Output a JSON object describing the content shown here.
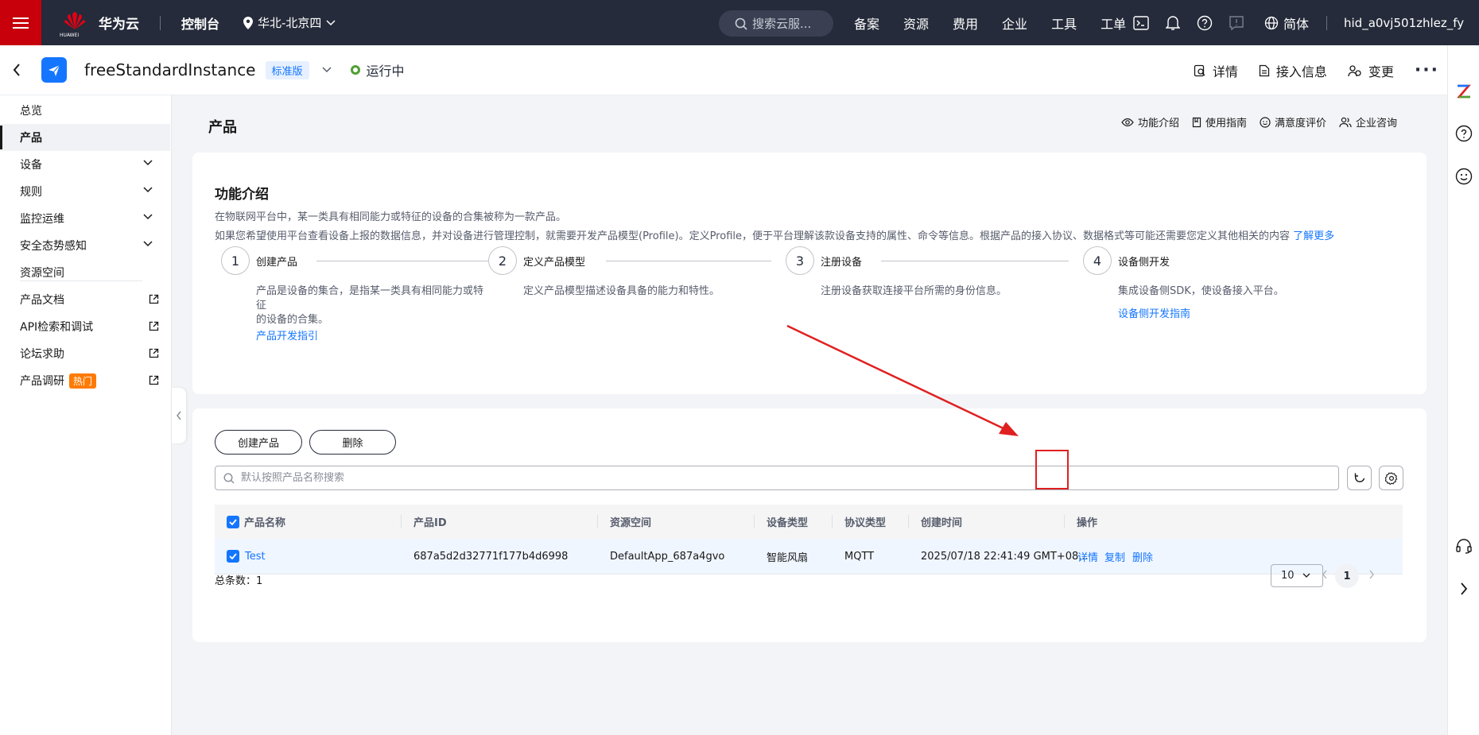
{
  "topbar": {
    "brand_small": "HUAWEI",
    "brand": "华为云",
    "console": "控制台",
    "region": "华北-北京四",
    "search_placeholder": "搜索云服...",
    "links": [
      "备案",
      "资源",
      "费用",
      "企业",
      "工具",
      "工单"
    ],
    "language": "简体",
    "user": "hid_a0vj501zhlez_fy"
  },
  "instance": {
    "name": "freeStandardInstance",
    "edition": "标准版",
    "status": "运行中",
    "actions": {
      "detail": "详情",
      "access_info": "接入信息",
      "change": "变更"
    }
  },
  "sidebar": {
    "items": [
      {
        "label": "总览"
      },
      {
        "label": "产品"
      },
      {
        "label": "设备"
      },
      {
        "label": "规则"
      },
      {
        "label": "监控运维"
      },
      {
        "label": "安全态势感知"
      },
      {
        "label": "资源空间"
      },
      {
        "label": "产品文档"
      },
      {
        "label": "API检索和调试"
      },
      {
        "label": "论坛求助"
      },
      {
        "label": "产品调研"
      }
    ],
    "hot_badge": "热门"
  },
  "page": {
    "title": "产品",
    "links": {
      "intro": "功能介绍",
      "guide": "使用指南",
      "rating": "满意度评价",
      "consult": "企业咨询"
    }
  },
  "intro": {
    "title": "功能介绍",
    "desc1": "在物联网平台中，某一类具有相同能力或特征的设备的合集被称为一款产品。",
    "desc2": "如果您希望使用平台查看设备上报的数据信息，并对设备进行管理控制，就需要开发产品模型(Profile)。定义Profile，便于平台理解该款设备支持的属性、命令等信息。根据产品的接入协议、数据格式等可能还需要您定义其他相关的内容",
    "learn_more": "了解更多",
    "steps": [
      {
        "num": "1",
        "title": "创建产品",
        "desc_line1": "产品是设备的集合，是指某一类具有相同能力或特征",
        "desc_line2": "的设备的合集。",
        "link": "产品开发指引"
      },
      {
        "num": "2",
        "title": "定义产品模型",
        "desc_line1": "定义产品模型描述设备具备的能力和特性。",
        "desc_line2": "",
        "link": ""
      },
      {
        "num": "3",
        "title": "注册设备",
        "desc_line1": "注册设备获取连接平台所需的身份信息。",
        "desc_line2": "",
        "link": ""
      },
      {
        "num": "4",
        "title": "设备侧开发",
        "desc_line1": "集成设备侧SDK，使设备接入平台。",
        "desc_line2": "",
        "link": "设备侧开发指南"
      }
    ]
  },
  "products": {
    "create_button": "创建产品",
    "delete_button": "删除",
    "search_placeholder": "默认按照产品名称搜索",
    "columns": [
      "产品名称",
      "产品ID",
      "资源空间",
      "设备类型",
      "协议类型",
      "创建时间",
      "操作"
    ],
    "rows": [
      {
        "name": "Test",
        "id": "687a5d2d32771f177b4d6998",
        "space": "DefaultApp_687a4gvo",
        "device_type": "智能风扇",
        "protocol": "MQTT",
        "created": "2025/07/18 22:41:49 GMT+08...",
        "actions": {
          "detail": "详情",
          "copy": "复制",
          "delete": "删除"
        }
      }
    ],
    "total_label": "总条数：",
    "total": "1",
    "page_size": "10",
    "current_page": "1"
  },
  "colors": {
    "brand_red": "#c7000b",
    "accent_blue": "#1476ff",
    "annotation_red": "#e02020"
  }
}
